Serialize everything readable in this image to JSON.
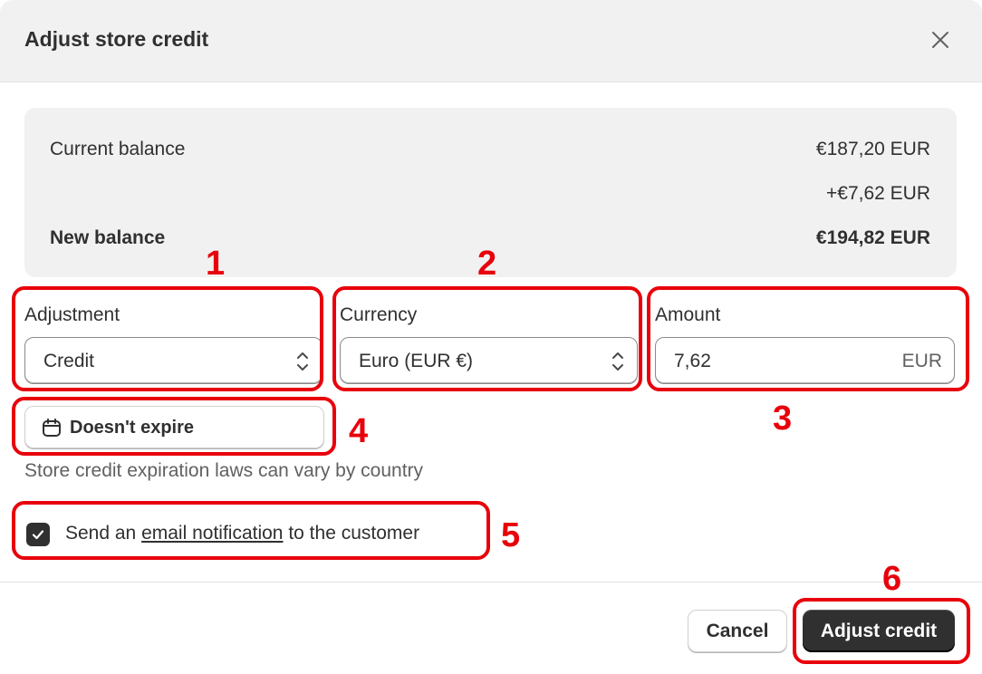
{
  "dialog": {
    "title": "Adjust store credit",
    "close_icon": "close-icon"
  },
  "summary": {
    "current_balance_label": "Current balance",
    "current_balance_value": "€187,20 EUR",
    "adjustment_value": "+€7,62 EUR",
    "new_balance_label": "New balance",
    "new_balance_value": "€194,82 EUR"
  },
  "form": {
    "adjustment": {
      "label": "Adjustment",
      "value": "Credit",
      "icon": "chevron-updown-icon"
    },
    "currency": {
      "label": "Currency",
      "value": "Euro (EUR €)",
      "icon": "chevron-updown-icon"
    },
    "amount": {
      "label": "Amount",
      "value": "7,62",
      "suffix": "EUR"
    },
    "expiry": {
      "label": "Doesn't expire",
      "icon": "calendar-icon"
    },
    "helper_text": "Store credit expiration laws can vary by country",
    "notify": {
      "checked": true,
      "text_before": "Send an ",
      "link_text": "email notification",
      "text_after": " to the customer"
    }
  },
  "footer": {
    "cancel_label": "Cancel",
    "submit_label": "Adjust credit"
  },
  "annotations": {
    "color": "#e8000b",
    "labels": [
      "1",
      "2",
      "3",
      "4",
      "5",
      "6"
    ]
  },
  "colors": {
    "header_bg": "#f1f1f1",
    "primary_button": "#303030",
    "text": "#303030",
    "muted_text": "#616161"
  }
}
